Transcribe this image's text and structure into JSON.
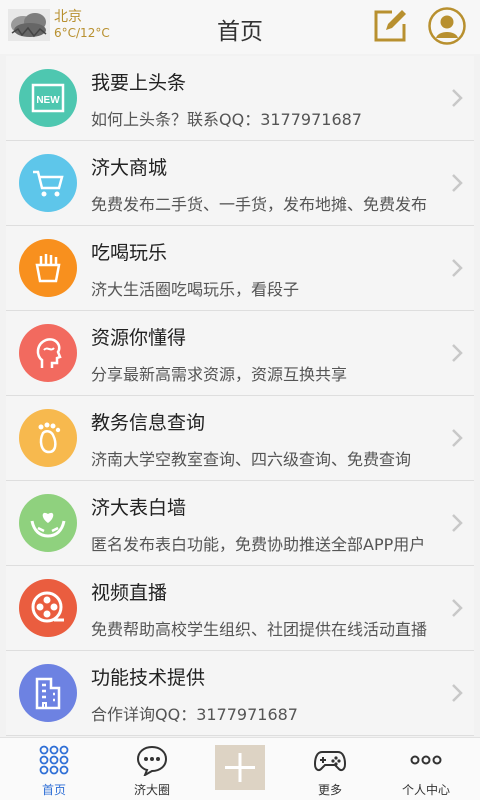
{
  "header": {
    "city": "北京",
    "temp": "6°C/12°C",
    "title": "首页",
    "weather_icon": "cloudy-weather-icon",
    "compose_icon": "compose-icon",
    "profile_icon": "user-avatar-icon",
    "accent": "#b8902f"
  },
  "items": [
    {
      "title": "我要上头条",
      "desc": "如何上头条？联系QQ：3177971687",
      "color": "#4ec7b0",
      "icon": "new-badge-icon"
    },
    {
      "title": "济大商城",
      "desc": "免费发布二手货、一手货，发布地摊、免费发布",
      "color": "#5ec6ea",
      "icon": "shopping-cart-icon"
    },
    {
      "title": "吃喝玩乐",
      "desc": "济大生活圈吃喝玩乐，看段子",
      "color": "#f8901e",
      "icon": "fries-icon"
    },
    {
      "title": "资源你懂得",
      "desc": "分享最新高需求资源，资源互换共享",
      "color": "#f26a5f",
      "icon": "head-profile-icon"
    },
    {
      "title": "教务信息查询",
      "desc": "济南大学空教室查询、四六级查询、免费查询",
      "color": "#f7b94e",
      "icon": "footprint-icon"
    },
    {
      "title": "济大表白墙",
      "desc": "匿名发布表白功能，免费协助推送全部APP用户",
      "color": "#8fd17e",
      "icon": "heart-hand-icon"
    },
    {
      "title": "视频直播",
      "desc": "免费帮助高校学生组织、社团提供在线活动直播",
      "color": "#ea5d3f",
      "icon": "film-reel-icon"
    },
    {
      "title": "功能技术提供",
      "desc": "合作详询QQ：3177971687",
      "color": "#6d82e2",
      "icon": "building-icon"
    }
  ],
  "tabs": [
    {
      "label": "首页",
      "icon": "grid-dots-icon",
      "active": true
    },
    {
      "label": "济大圈",
      "icon": "chat-bubble-icon",
      "active": false
    },
    {
      "label": "",
      "icon": "plus-icon",
      "active": false
    },
    {
      "label": "更多",
      "icon": "gamepad-icon",
      "active": false
    },
    {
      "label": "个人中心",
      "icon": "more-dots-icon",
      "active": false
    }
  ]
}
